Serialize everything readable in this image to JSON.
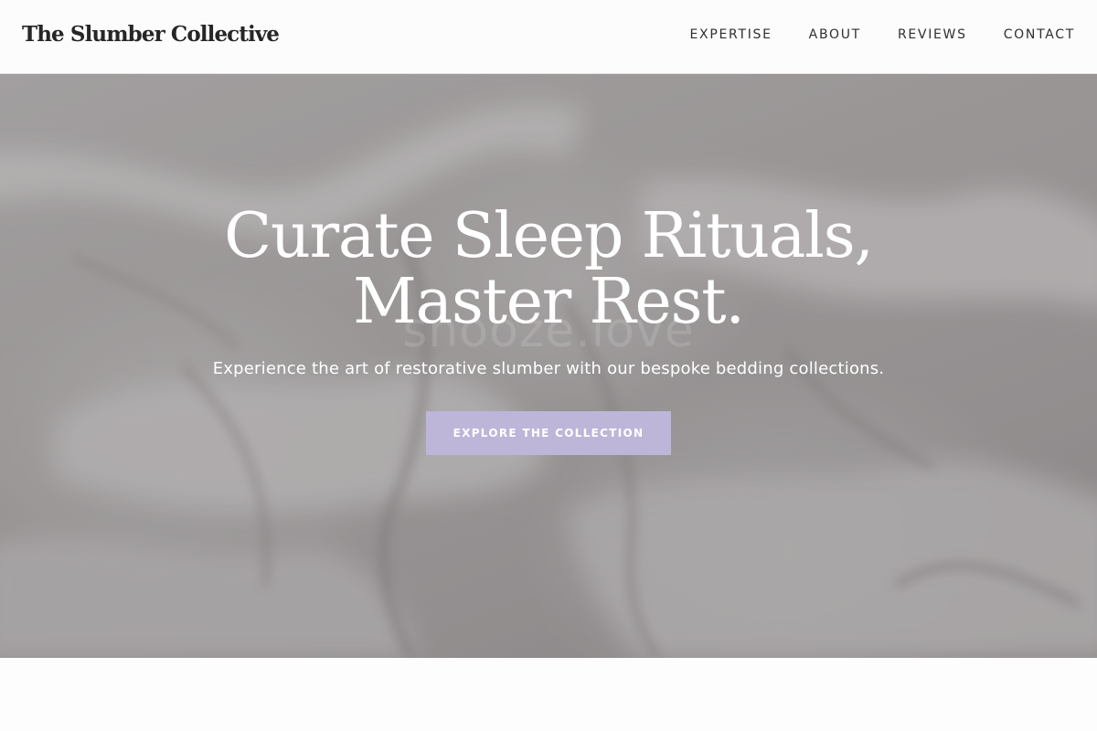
{
  "header": {
    "brand": "The Slumber Collective",
    "nav": [
      "EXPERTISE",
      "ABOUT",
      "REVIEWS",
      "CONTACT"
    ]
  },
  "hero": {
    "headline_line1": "Curate Sleep Rituals,",
    "headline_line2": "Master Rest.",
    "watermark": "snooze.love",
    "subheadline": "Experience the art of restorative slumber with our bespoke bedding collections.",
    "cta_label": "EXPLORE THE COLLECTION"
  },
  "colors": {
    "accent": "#beb6d9",
    "text_dark": "#262626",
    "hero_text": "#ffffff"
  }
}
